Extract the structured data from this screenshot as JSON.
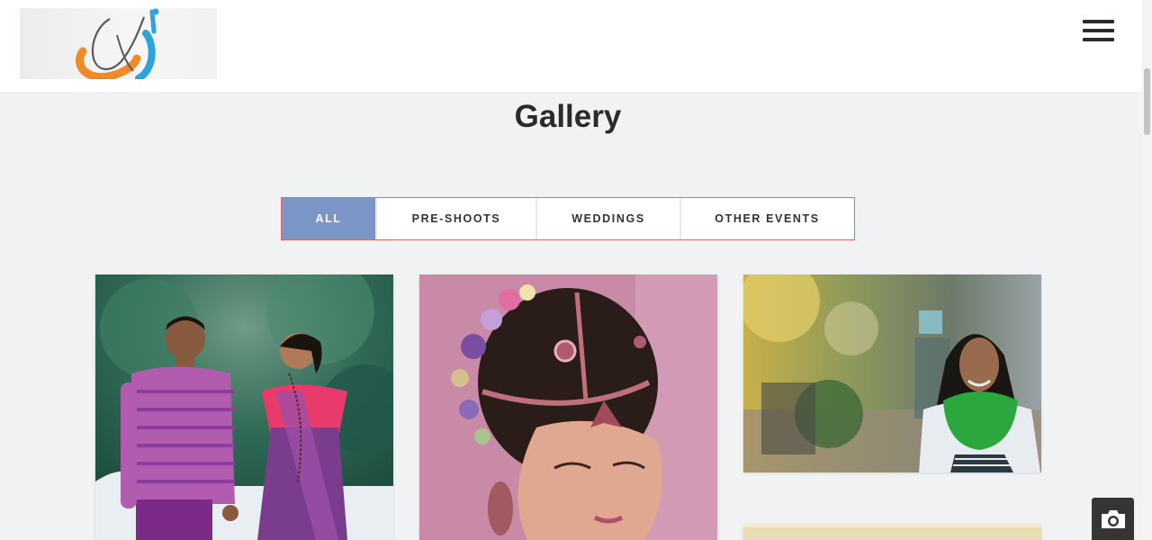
{
  "header": {
    "logo_name": "brand-logo",
    "menu_icon": "hamburger-menu-icon"
  },
  "gallery": {
    "title": "Gallery"
  },
  "filters": [
    {
      "label": "ALL",
      "active": true
    },
    {
      "label": "PRE-SHOOTS",
      "active": false
    },
    {
      "label": "WEDDINGS",
      "active": false
    },
    {
      "label": "OTHER EVENTS",
      "active": false
    }
  ],
  "photos": [
    {
      "name": "couple-traditional-outfits-photo"
    },
    {
      "name": "bride-headdress-closeup-photo"
    },
    {
      "name": "woman-green-scarf-street-photo"
    },
    {
      "name": "partial-gallery-photo"
    }
  ],
  "floating": {
    "camera_icon": "camera-icon"
  },
  "colors": {
    "accent": "#7b95c6",
    "filter_border": "#e26a6a",
    "background": "#f1f2f4"
  }
}
